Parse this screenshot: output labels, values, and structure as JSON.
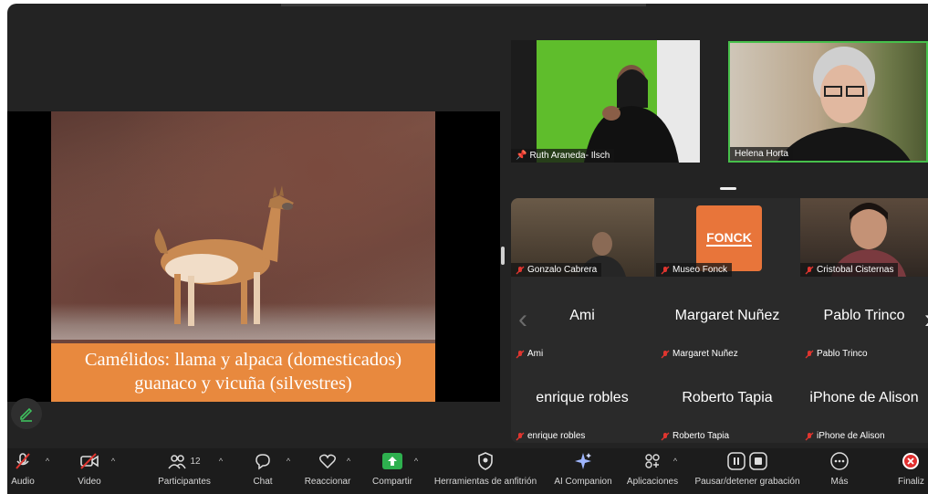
{
  "share": {
    "caption_line1": "Camélidos: llama y alpaca (domesticados)",
    "caption_line2": "guanaco y vicuña (silvestres)"
  },
  "speakers": [
    {
      "name": "Ruth Araneda- Ilsch",
      "pinned": true
    },
    {
      "name": "Helena Horta",
      "active": true
    }
  ],
  "gallery": {
    "video_tiles": [
      {
        "name": "Gonzalo Cabrera",
        "muted": true
      },
      {
        "name": "Museo Fonck",
        "muted": true,
        "logo_text": "FONCK"
      },
      {
        "name": "Cristobal Cisternas",
        "muted": true
      }
    ],
    "name_tiles": [
      {
        "display": "Ami",
        "label": "Ami"
      },
      {
        "display": "Margaret Nuñez",
        "label": "Margaret Nuñez"
      },
      {
        "display": "Pablo Trinco",
        "label": "Pablo Trinco"
      },
      {
        "display": "enrique robles",
        "label": "enrique robles"
      },
      {
        "display": "Roberto Tapia",
        "label": "Roberto Tapia"
      },
      {
        "display": "iPhone de Alison",
        "label": "iPhone de Alison"
      }
    ]
  },
  "toolbar": {
    "audio": "Audio",
    "video": "Video",
    "participants": "Participantes",
    "participants_count": "12",
    "chat": "Chat",
    "react": "Reaccionar",
    "share": "Compartir",
    "host_tools": "Herramientas de anfitrión",
    "companion": "AI Companion",
    "apps": "Aplicaciones",
    "record": "Pausar/detener grabación",
    "more": "Más",
    "end": "Finaliz"
  },
  "colors": {
    "active_speaker_border": "#47c04b",
    "share_button": "#2eb04f",
    "end_button": "#e02f2f",
    "muted_icon": "#e0352f",
    "caption_bg": "#e8893e"
  }
}
